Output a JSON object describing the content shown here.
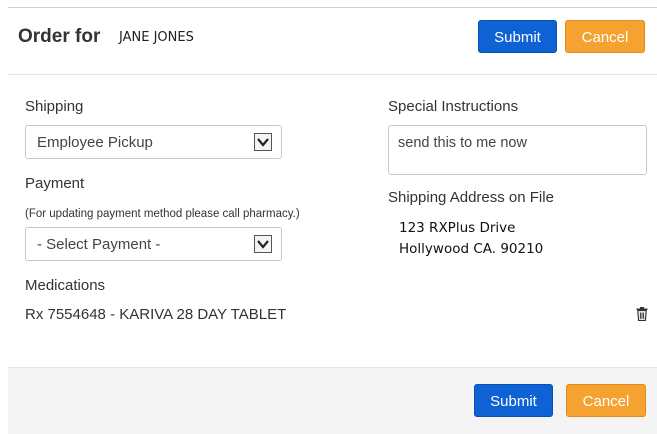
{
  "header": {
    "title": "Order for",
    "patient_name": "JANE JONES",
    "submit_label": "Submit",
    "cancel_label": "Cancel"
  },
  "shipping": {
    "label": "Shipping",
    "selected": "Employee Pickup"
  },
  "payment": {
    "label": "Payment",
    "note": "(For updating payment method please call pharmacy.)",
    "selected": "- Select Payment -"
  },
  "special_instructions": {
    "label": "Special Instructions",
    "value": "send this to me now"
  },
  "address": {
    "label": "Shipping Address on File",
    "line1": "123 RXPlus Drive",
    "line2": "Hollywood CA. 90210"
  },
  "medications": {
    "label": "Medications",
    "items": [
      {
        "text": "Rx 7554648 - KARIVA 28 DAY TABLET",
        "icon": "trash-icon"
      }
    ]
  },
  "footer": {
    "submit_label": "Submit",
    "cancel_label": "Cancel"
  },
  "colors": {
    "primary": "#0e62d4",
    "warning": "#f6a231",
    "footer_bg": "#f4f4f4"
  }
}
